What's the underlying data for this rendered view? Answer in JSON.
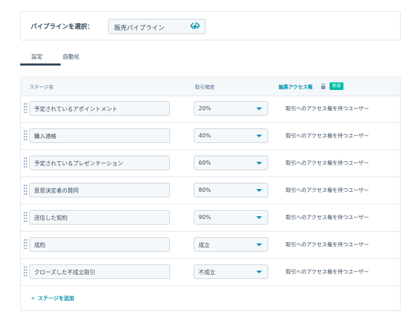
{
  "pipeline": {
    "label": "パイプラインを選択：",
    "selected": "販売パイプライン",
    "code_icon": "code-icon"
  },
  "tabs": [
    {
      "label": "設定",
      "active": true
    },
    {
      "label": "自動化",
      "active": false
    }
  ],
  "table": {
    "headers": {
      "stage_name": "ステージ名",
      "probability": "取引確度",
      "access": "編集アクセス権",
      "new_badge": "新規"
    },
    "rows": [
      {
        "stage": "予定されているアポイントメント",
        "probability": "20%",
        "access": "取引へのアクセス権を持つユーザー"
      },
      {
        "stage": "購入適格",
        "probability": "40%",
        "access": "取引へのアクセス権を持つユーザー"
      },
      {
        "stage": "予定されているプレゼンテーション",
        "probability": "60%",
        "access": "取引へのアクセス権を持つユーザー"
      },
      {
        "stage": "意思決定者の賛同",
        "probability": "80%",
        "access": "取引へのアクセス権を持つユーザー"
      },
      {
        "stage": "送信した契約",
        "probability": "90%",
        "access": "取引へのアクセス権を持つユーザー"
      },
      {
        "stage": "成約",
        "probability": "成立",
        "access": "取引へのアクセス権を持つユーザー"
      },
      {
        "stage": "クローズした不成立取引",
        "probability": "不成立",
        "access": "取引へのアクセス権を持つユーザー"
      }
    ],
    "add_stage": "ステージを追加"
  },
  "colors": {
    "accent": "#0091ae",
    "badge": "#00bda5",
    "text": "#33475b",
    "border": "#cbd6e2"
  }
}
